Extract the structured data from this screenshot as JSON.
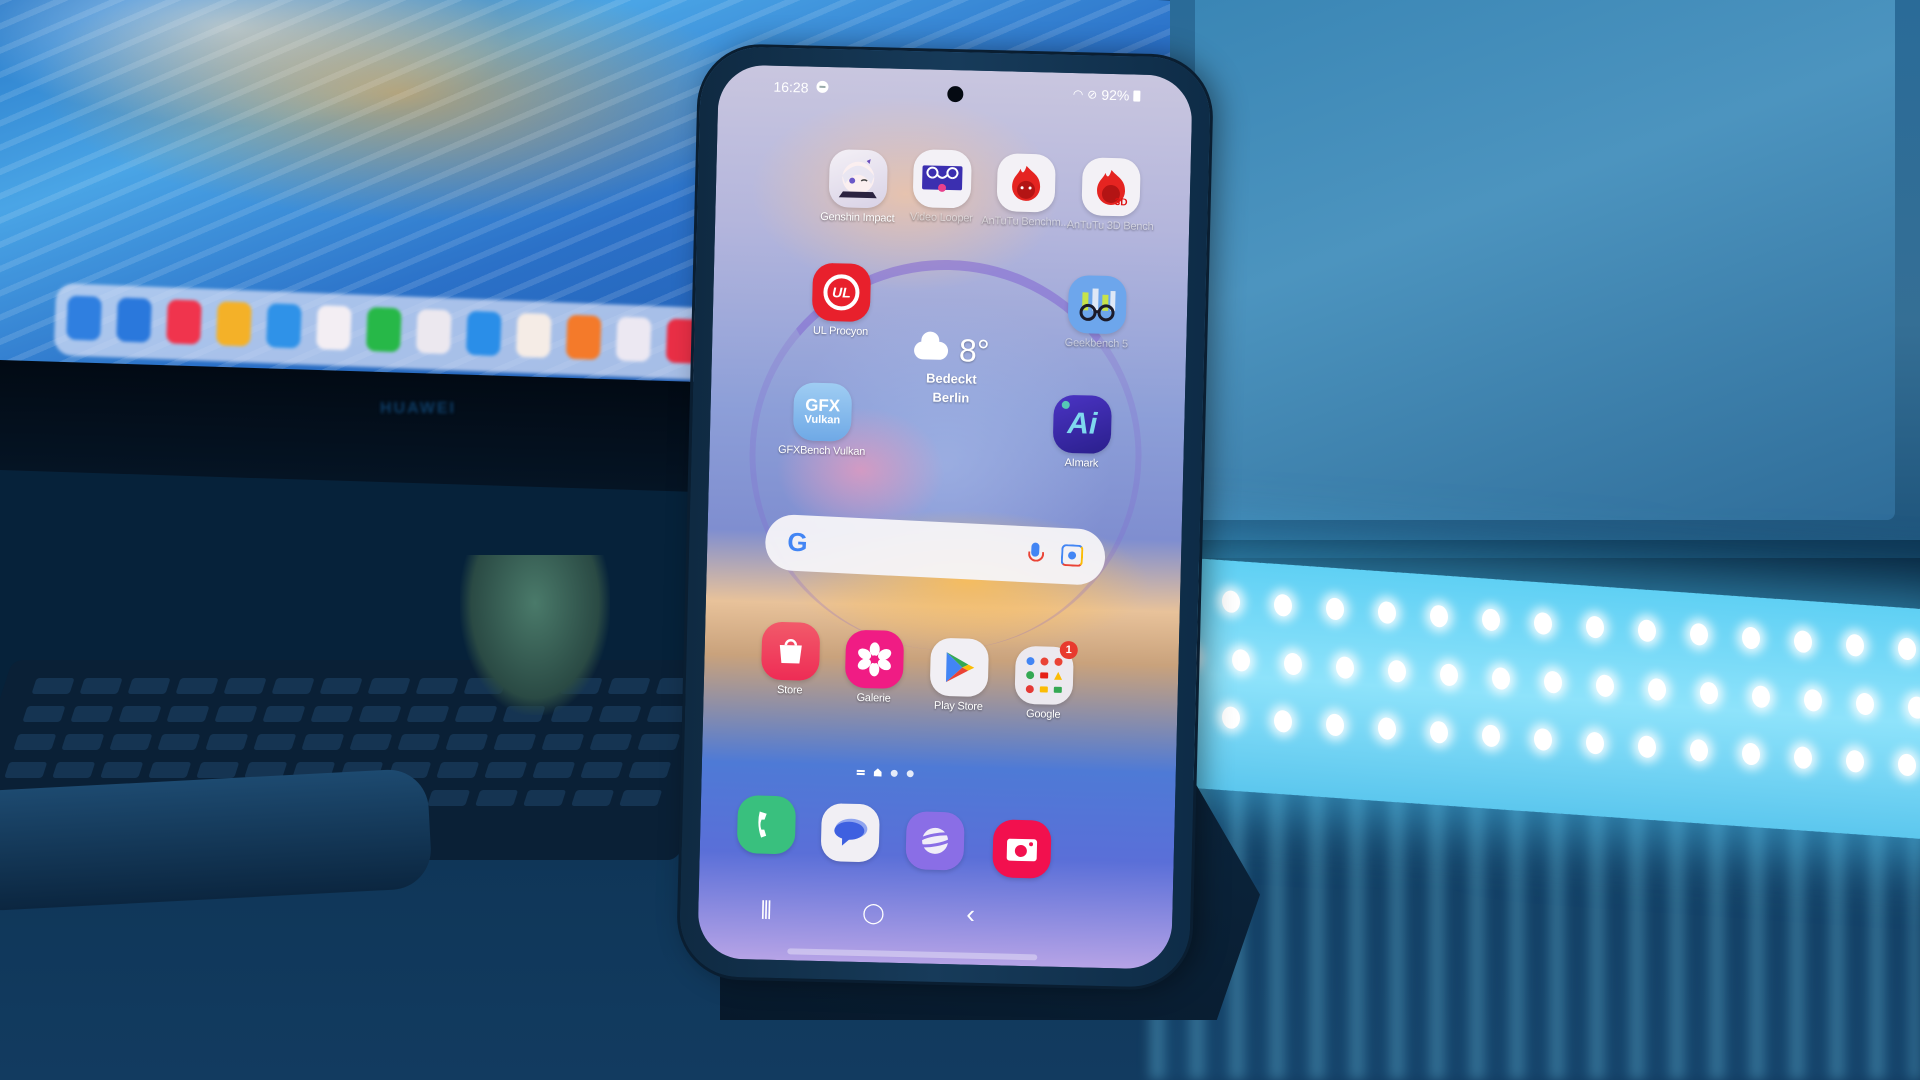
{
  "scene": {
    "monitor_brand": "HUAWEI",
    "colors": {
      "ambient_blue": "#1f6fc2",
      "led_cyan": "#8ee3fb"
    }
  },
  "status_bar": {
    "time": "16:28",
    "battery": "92%",
    "icons": [
      "do-not-disturb-icon",
      "wifi-icon",
      "no-sound-icon",
      "battery-icon"
    ]
  },
  "home_screen": {
    "row1": [
      {
        "label": "Genshin Impact",
        "icon": "genshin-impact-icon",
        "color": "#f2eef4"
      },
      {
        "label": "Video Looper",
        "icon": "video-looper-icon",
        "color": "#f3f1f6"
      },
      {
        "label": "AnTuTu Benchm...",
        "icon": "antutu-icon",
        "color": "#f3f1f6"
      },
      {
        "label": "AnTuTu 3D Bench",
        "icon": "antutu-3d-icon",
        "color": "#f3f1f6",
        "sub": "3D"
      }
    ],
    "ul_procyon": {
      "label": "UL Procyon",
      "icon": "ul-procyon-icon",
      "color": "#e8202c",
      "glyph": "UL"
    },
    "geekbench": {
      "label": "Geekbench 5",
      "icon": "geekbench-icon",
      "color": "#6da6ec"
    },
    "gfxbench": {
      "label": "GFXBench Vulkan",
      "icon": "gfxbench-icon",
      "color": "#8fc0ee",
      "glyph_top": "GFX",
      "glyph_bottom": "Vulkan"
    },
    "aimark": {
      "label": "AImark",
      "icon": "aimark-icon",
      "color": "#3e2aa8",
      "glyph": "Ai"
    },
    "weather": {
      "temperature": "8°",
      "condition": "Bedeckt",
      "city": "Berlin"
    },
    "search": {
      "logo": "G",
      "placeholder": ""
    },
    "row_apps": [
      {
        "label": "Store",
        "icon": "galaxy-store-icon",
        "color": "#f23a63"
      },
      {
        "label": "Galerie",
        "icon": "gallery-icon",
        "color": "#f01c84"
      },
      {
        "label": "Play Store",
        "icon": "play-store-icon",
        "color": "#f1eff4"
      },
      {
        "label": "Google",
        "icon": "google-folder-icon",
        "color": "#ece9ef",
        "badge": "1"
      }
    ],
    "page_indicator": {
      "pages": 3,
      "current": 1
    },
    "dock": [
      {
        "icon": "phone-icon",
        "color": "#39c07e"
      },
      {
        "icon": "messages-icon",
        "color": "#f1eff4"
      },
      {
        "icon": "samsung-internet-icon",
        "color": "#8a6ee6"
      },
      {
        "icon": "camera-icon",
        "color": "#f2104e"
      }
    ],
    "nav": {
      "recents": "|||",
      "home": "◯",
      "back": "‹"
    }
  }
}
